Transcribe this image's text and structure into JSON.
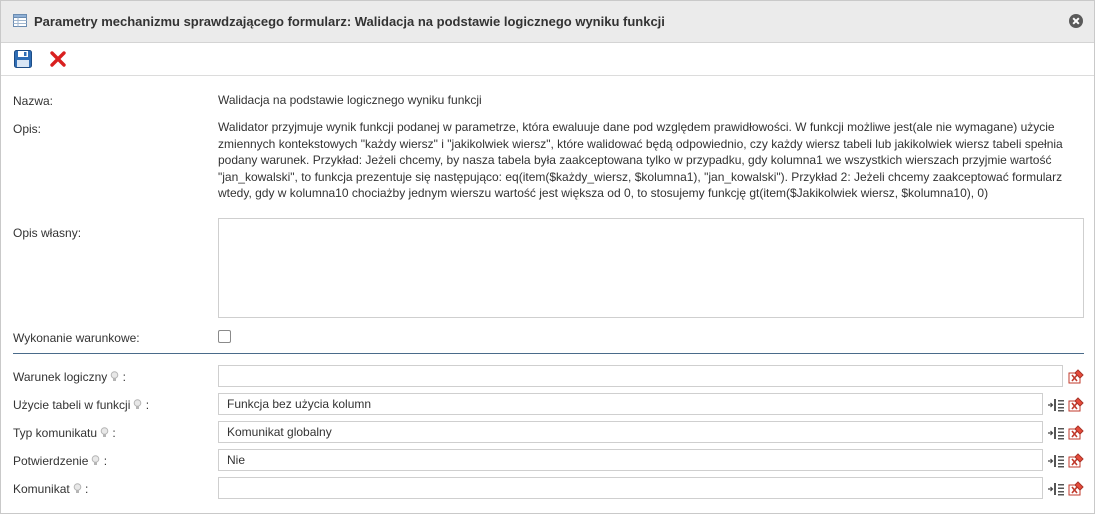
{
  "dialog": {
    "title": "Parametry mechanizmu sprawdzającego formularz: Walidacja na podstawie logicznego wyniku funkcji"
  },
  "toolbar": {
    "save_icon": "floppy-disk-icon",
    "cancel_icon": "red-x-icon"
  },
  "fields": {
    "name_label": "Nazwa:",
    "name_value": "Walidacja na podstawie logicznego wyniku funkcji",
    "desc_label": "Opis:",
    "desc_value": "Walidator przyjmuje wynik funkcji podanej w parametrze, która ewaluuje dane pod względem prawidłowości. W funkcji możliwe jest(ale nie wymagane) użycie zmiennych kontekstowych \"każdy wiersz\" i \"jakikolwiek wiersz\", które walidować będą odpowiednio, czy każdy wiersz tabeli lub jakikolwiek wiersz tabeli spełnia podany warunek. Przykład: Jeżeli chcemy, by nasza tabela była zaakceptowana tylko w przypadku, gdy kolumna1 we wszystkich wierszach przyjmie wartość \"jan_kowalski\", to funkcja prezentuje się następująco: eq(item($każdy_wiersz, $kolumna1), \"jan_kowalski\"). Przykład 2: Jeżeli chcemy zaakceptować formularz wtedy, gdy w kolumna10 chociażby jednym wierszu wartość jest większa od 0, to stosujemy funkcję gt(item($Jakikolwiek wiersz, $kolumna10), 0)",
    "own_desc_label": "Opis własny:",
    "own_desc_value": "",
    "conditional_label": "Wykonanie warunkowe:",
    "conditional_checked": false
  },
  "params": [
    {
      "label": "Warunek logiczny",
      "value": ""
    },
    {
      "label": "Użycie tabeli w funkcji",
      "value": "Funkcja bez użycia kolumn"
    },
    {
      "label": "Typ komunikatu",
      "value": "Komunikat globalny"
    },
    {
      "label": "Potwierdzenie",
      "value": "Nie"
    },
    {
      "label": "Komunikat",
      "value": ""
    }
  ],
  "colors": {
    "separator": "#4a6b8a",
    "clear_icon": "#c0392b"
  }
}
